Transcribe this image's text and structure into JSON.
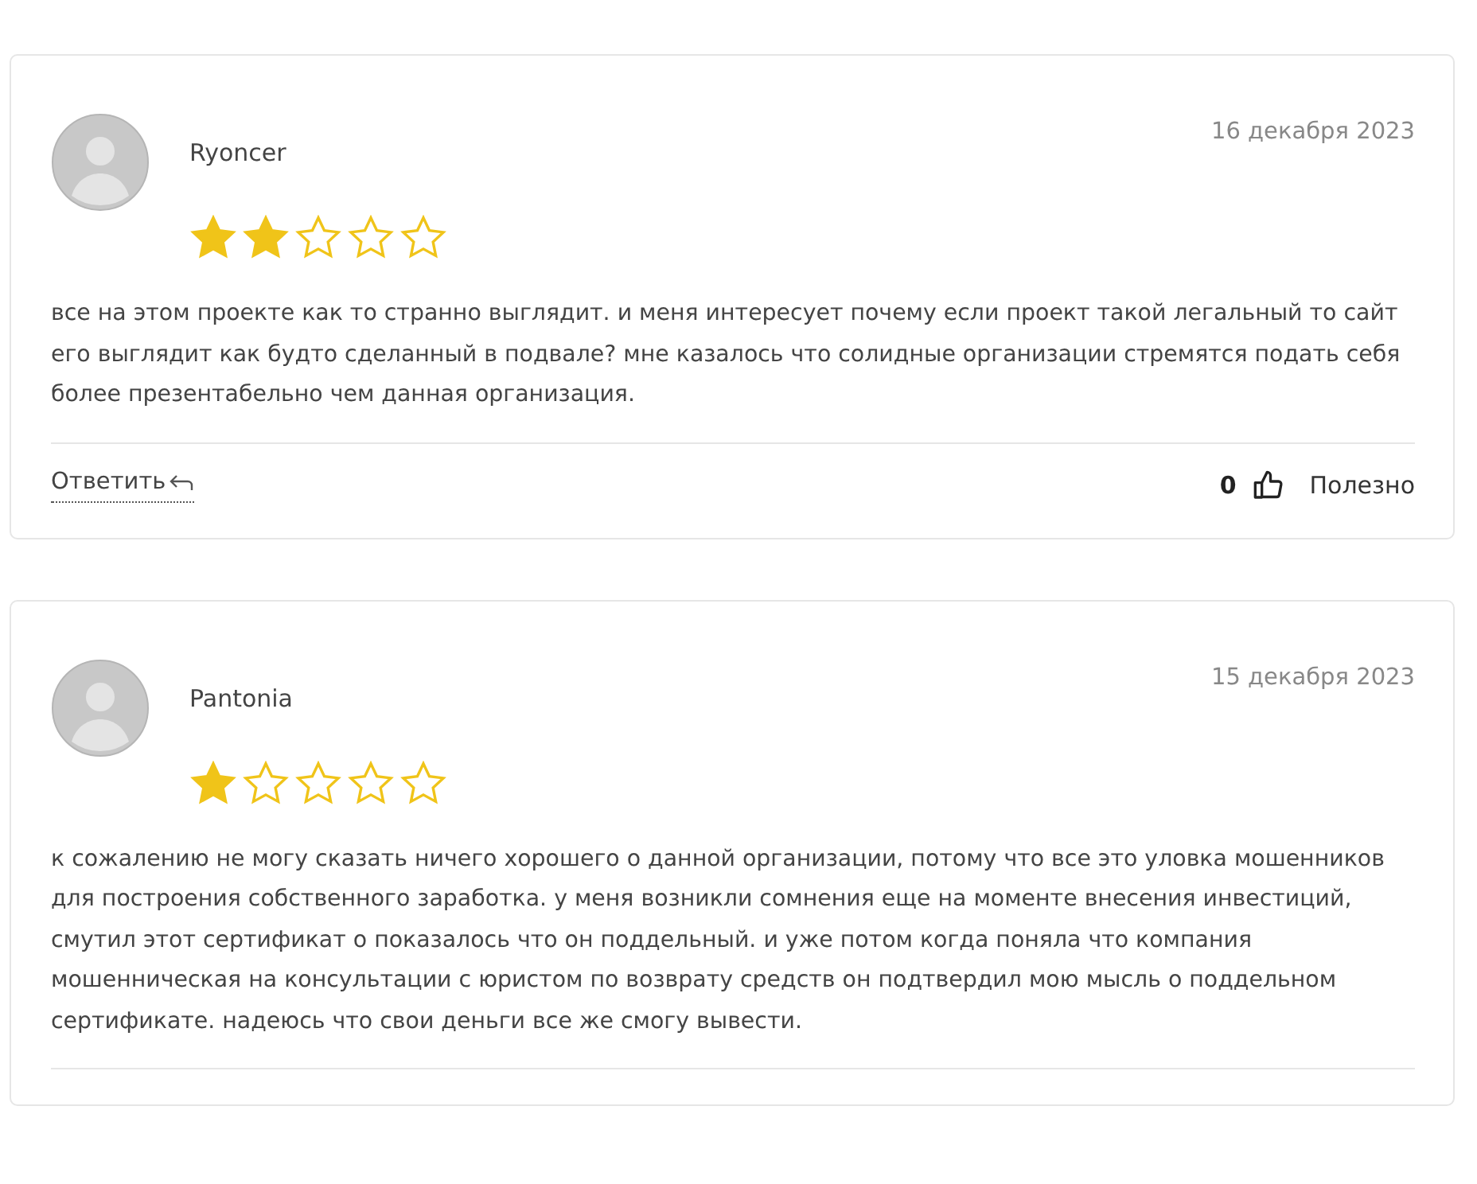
{
  "reviews": [
    {
      "author": "Ryoncer",
      "date": "16 декабря 2023",
      "stars": 2,
      "text": "все на этом проекте как то странно выглядит. и меня интересует почему если проект такой легальный то сайт его выглядит как будто сделанный в подвале? мне казалось что солидные организации стремятся подать себя более презентабельно чем данная организация.",
      "footer": {
        "reply": "Ответить",
        "likes": "0",
        "helpful": "Полезно"
      }
    },
    {
      "author": "Pantonia",
      "date": "15 декабря 2023",
      "stars": 1,
      "text": "к сожалению не могу сказать ничего хорошего о данной организации, потому что все это уловка мошенников для построения собственного заработка. у меня возникли сомнения еще на моменте внесения инвестиций, смутил этот сертификат о показалось что он поддельный. и уже потом когда поняла что компания мошенническая на консультации с юристом по возврату средств он подтвердил мою мысль о поддельном сертификате. надеюсь что свои деньги все же смогу вывести."
    }
  ]
}
